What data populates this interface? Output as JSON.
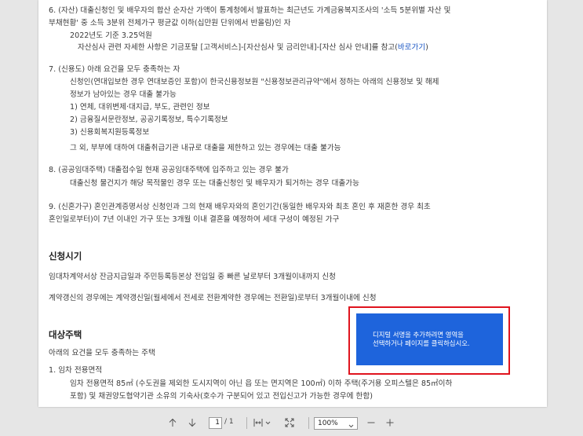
{
  "document": {
    "item6_line1": "6. (자산) 대출신청인 및 배우자의 합산 순자산 가액이 통계청에서 발표하는 최근년도 가계금융복지조사의 '소득 5분위별 자산 및",
    "item6_line2": "부채현황' 중 소득 3분위 전체가구 평균값 이하(십만원 단위에서 반올림)인 자",
    "item6_line3": "2022년도 기준 3.25억원",
    "item6_line4": "자산심사 관련 자세한 사항은 기금포탈 [고객서비스]-[자산심사 및 금리안내]-[자산 심사 안내]를 참고(",
    "item6_link": "바로가기",
    "item6_close": ")",
    "item7_line1": "7. (신용도) 아래 요건을 모두 충족하는 자",
    "item7_line2": "신청인(연대입보한 경우 연대보증인 포함)이 한국신용정보원 \"신용정보관리규약\"에서 정하는 아래의 신용정보 및 해제",
    "item7_line3": "정보가 남아있는 경우 대출 불가능",
    "item7_sub1": "1) 연체, 대위변제·대지급, 부도, 관련인 정보",
    "item7_sub2": "2) 금융질서문란정보, 공공기록정보, 특수기록정보",
    "item7_sub3": "3) 신용회복지원등록정보",
    "item7_line4": "그 외, 부부에 대하여 대출취급기관 내규로 대출을 제한하고 있는 경우에는 대출 불가능",
    "item8_line1": "8. (공공임대주택) 대출접수일 현재 공공임대주택에 입주하고 있는 경우 불가",
    "item8_line2": "대출신청 물건지가 해당 목적물인 경우 또는 대출신청인 및 배우자가 퇴거하는 경우 대출가능",
    "item9_line1": "9. (신혼가구) 혼인관계증명서상 신청인과 그의 현재 배우자와의 혼인기간(동일한 배우자와 최초 혼인 후 재혼한 경우 최초",
    "item9_line2": "혼인일로부터)이 7년 이내인 가구 또는 3개월 이내 결혼을 예정하여 세대 구성이 예정된 가구",
    "section_timing_title": "신청시기",
    "timing_line1": "임대차계약서상 잔금지급일과 주민등록등본상 전입일 중 빠른 날로부터 3개월이내까지 신청",
    "timing_line2": "계약갱신의 경우에는 계약갱신일(월세에서 전세로 전환계약한 경우에는 전환일)로부터 3개월이내에 신청",
    "section_house_title": "대상주택",
    "house_line1": "아래의 요건을 모두 충족하는 주택",
    "house_item1": "1. 임차 전용면적",
    "house_line2": "임차 전용면적 85㎡ (수도권을 제외한 도시지역이 아닌 읍 또는 면지역은 100㎡) 이하 주택(주거용 오피스텔은 85㎡이하",
    "house_line3": "포함) 및 채권양도협약기관 소유의 기숙사(호수가 구분되어 있고 전입신고가 가능한 경우에 한함)"
  },
  "signature_prompt": {
    "line1": "디지털 서명을 추가하려면 영역을",
    "line2": "선택하거나 페이지를 클릭하십시오."
  },
  "toolbar": {
    "current_page": "1",
    "page_total": "/ 1",
    "zoom_level": "100%"
  },
  "colors": {
    "signature_box": "#1e64dc",
    "signature_outline": "#e0141e",
    "link": "#1a56c4"
  }
}
